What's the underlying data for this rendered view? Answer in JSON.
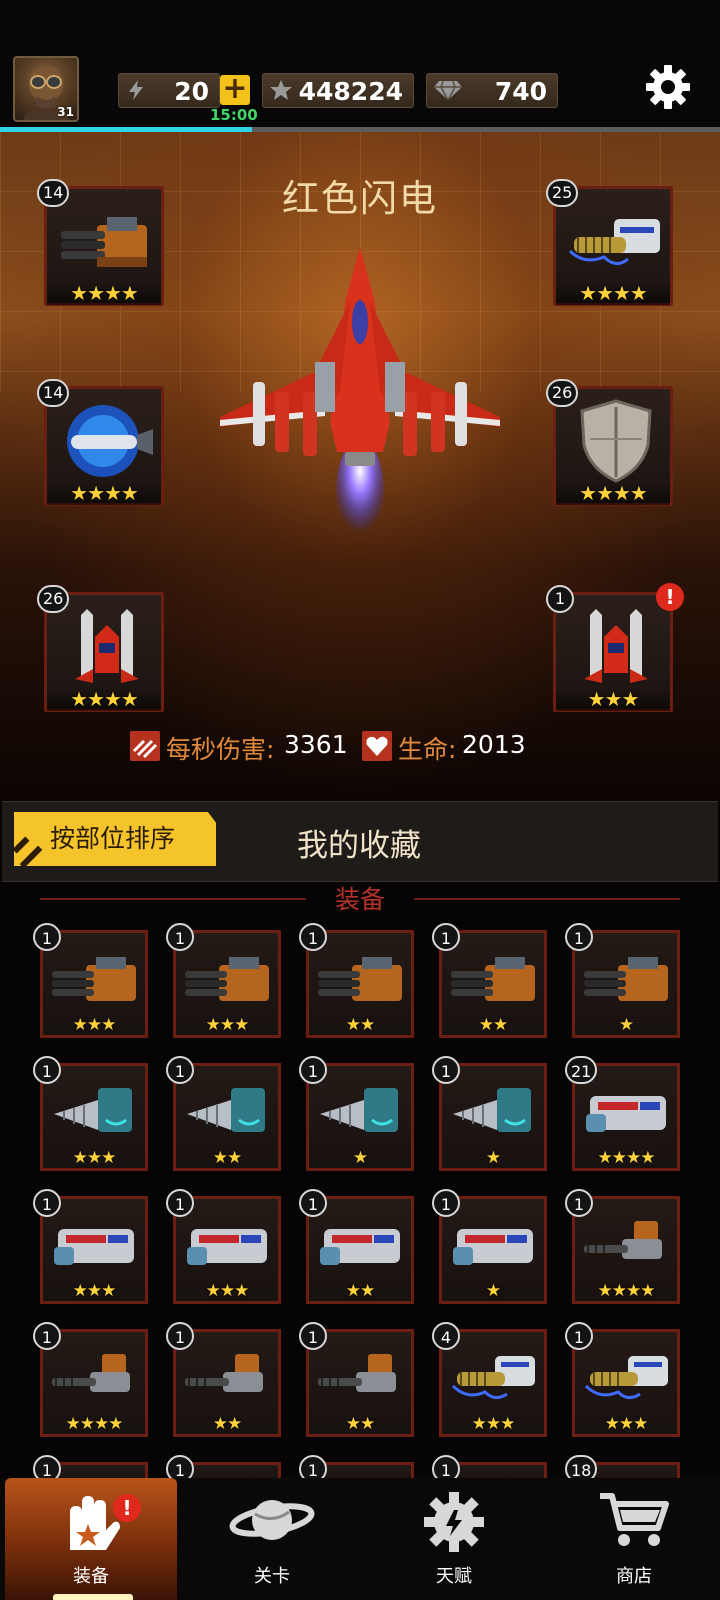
{
  "player": {
    "level": "31",
    "avatar_icon": "pilot-avatar"
  },
  "resources": {
    "energy": "20",
    "energy_timer": "15:00",
    "energy_fill": 0.35,
    "stars": "448224",
    "gems": "740"
  },
  "ship": {
    "name": "红色闪电",
    "dps_label": "每秒伤害:",
    "dps_value": "3361",
    "hp_label": "生命:",
    "hp_value": "2013"
  },
  "slots": [
    {
      "level": "14",
      "stars": "★★★★",
      "icon": "gatling-gun-icon"
    },
    {
      "level": "25",
      "stars": "★★★★",
      "icon": "plasma-cannon-icon"
    },
    {
      "level": "14",
      "stars": "★★★★",
      "icon": "plasma-missile-icon"
    },
    {
      "level": "26",
      "stars": "★★★★",
      "icon": "shield-icon"
    },
    {
      "level": "26",
      "stars": "★★★★",
      "icon": "wingman-drone-icon"
    },
    {
      "level": "1",
      "stars": "★★★",
      "icon": "wingman-drone-icon",
      "alert": "!"
    }
  ],
  "sort": {
    "button": "按部位排序",
    "favorites": "我的收藏"
  },
  "inventory": {
    "title": "装备",
    "rows": [
      [
        {
          "level": "1",
          "stars": "★★★",
          "icon": "gatling-gun-icon"
        },
        {
          "level": "1",
          "stars": "★★★",
          "icon": "gatling-gun-icon"
        },
        {
          "level": "1",
          "stars": "★★",
          "icon": "gatling-gun-icon"
        },
        {
          "level": "1",
          "stars": "★★",
          "icon": "gatling-gun-icon"
        },
        {
          "level": "1",
          "stars": "★",
          "icon": "gatling-gun-icon"
        }
      ],
      [
        {
          "level": "1",
          "stars": "★★★",
          "icon": "drill-cannon-icon"
        },
        {
          "level": "1",
          "stars": "★★",
          "icon": "drill-cannon-icon"
        },
        {
          "level": "1",
          "stars": "★",
          "icon": "drill-cannon-icon"
        },
        {
          "level": "1",
          "stars": "★",
          "icon": "drill-cannon-icon"
        },
        {
          "level": "21",
          "stars": "★★★★",
          "icon": "laser-cannon-icon"
        }
      ],
      [
        {
          "level": "1",
          "stars": "★★★",
          "icon": "laser-cannon-icon"
        },
        {
          "level": "1",
          "stars": "★★★",
          "icon": "laser-cannon-icon"
        },
        {
          "level": "1",
          "stars": "★★",
          "icon": "laser-cannon-icon"
        },
        {
          "level": "1",
          "stars": "★",
          "icon": "laser-cannon-icon"
        },
        {
          "level": "1",
          "stars": "★★★★",
          "icon": "minigun-icon"
        }
      ],
      [
        {
          "level": "1",
          "stars": "★★★★",
          "icon": "minigun-icon"
        },
        {
          "level": "1",
          "stars": "★★",
          "icon": "minigun-icon"
        },
        {
          "level": "1",
          "stars": "★★",
          "icon": "minigun-icon"
        },
        {
          "level": "4",
          "stars": "★★★",
          "icon": "plasma-cannon-icon"
        },
        {
          "level": "1",
          "stars": "★★★",
          "icon": "plasma-cannon-icon"
        }
      ],
      [
        {
          "level": "1"
        },
        {
          "level": "1"
        },
        {
          "level": "1"
        },
        {
          "level": "1"
        },
        {
          "level": "18"
        }
      ]
    ]
  },
  "nav": {
    "items": [
      {
        "label": "装备",
        "icon": "equipment-icon",
        "alert": "!"
      },
      {
        "label": "关卡",
        "icon": "planet-icon"
      },
      {
        "label": "天赋",
        "icon": "talent-gear-icon"
      },
      {
        "label": "商店",
        "icon": "shop-cart-icon"
      }
    ]
  },
  "colors": {
    "accent_gold": "#f5c42a",
    "frame_red": "#6b1e12",
    "energy_cyan": "#2ed3e6",
    "timer_green": "#3fd66b",
    "alert_red": "#e0291d"
  }
}
